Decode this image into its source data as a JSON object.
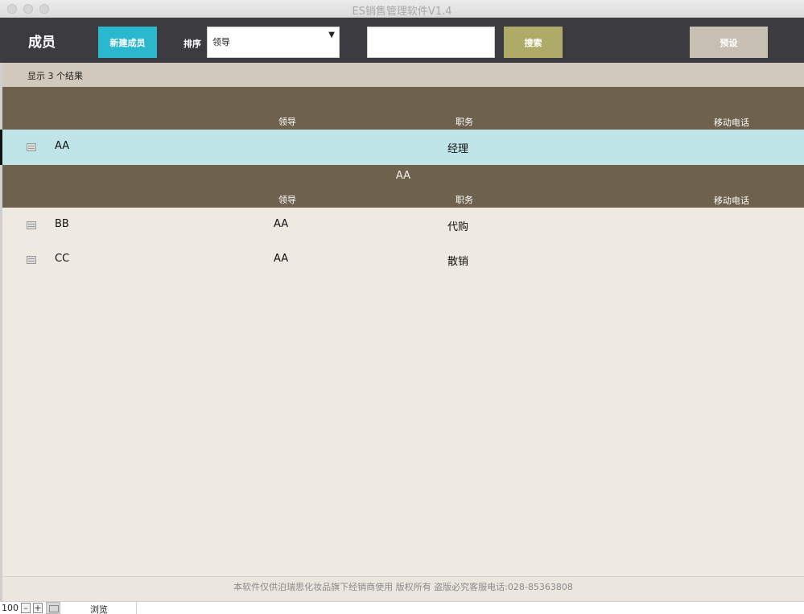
{
  "window": {
    "title": "ES销售管理软件V1.4"
  },
  "header": {
    "title": "成员",
    "new_button": "新建成员",
    "sort_label": "排序",
    "sort_value": "领导",
    "search_placeholder": "",
    "search_button": "搜索",
    "preset_button": "预设"
  },
  "results": {
    "text": "显示 3 个结果"
  },
  "columns": {
    "leader": "领导",
    "job": "职务",
    "phone": "移动电话"
  },
  "groups": [
    {
      "name": "",
      "rows": [
        {
          "name": "AA",
          "leader": "",
          "job": "经理",
          "phone": ""
        }
      ]
    },
    {
      "name": "AA",
      "rows": [
        {
          "name": "BB",
          "leader": "AA",
          "job": "代购",
          "phone": ""
        },
        {
          "name": "CC",
          "leader": "AA",
          "job": "散销",
          "phone": ""
        }
      ]
    }
  ],
  "footer": {
    "text": "本软件仅供泊瑞思化妆品旗下经销商使用 版权所有 盗版必究客服电话:028-85363808"
  },
  "statusbar": {
    "zoom": "100",
    "zoom_out": "–",
    "zoom_in": "+",
    "mode": "浏览"
  },
  "colors": {
    "header_bg": "#3c3c40",
    "new_button": "#2bb8cf",
    "search_button": "#aeaa68",
    "preset_button": "#c8bfb3",
    "group_header": "#6e624f",
    "selected_row": "#bfe5e8",
    "content_bg": "#eeeae1"
  }
}
